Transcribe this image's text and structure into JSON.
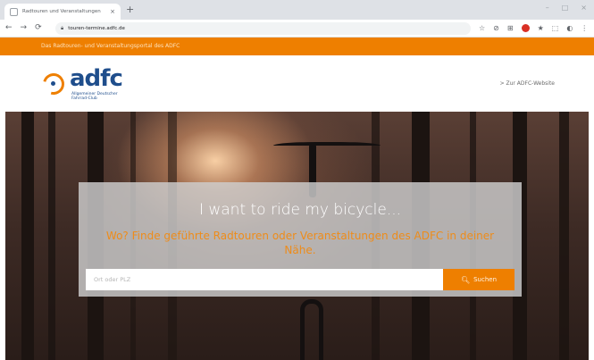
{
  "browser": {
    "tab_title": "Radtouren und Veranstaltungen",
    "tab_close": "×",
    "new_tab": "+",
    "url": "touren-termine.adfc.de",
    "nav": {
      "back": "←",
      "forward": "→",
      "reload": "⟳"
    },
    "window_controls": [
      "–",
      "□",
      "×"
    ],
    "extensions": [
      "☆",
      "⊘",
      "⊞",
      "⬤",
      "★",
      "⬚",
      "◐",
      "⋮"
    ]
  },
  "banner": {
    "text": "Das Radtouren- und Veranstaltungsportal des ADFC"
  },
  "header": {
    "logo_word": "adfc",
    "logo_subtitle": "Allgemeiner Deutscher Fahrrad-Club",
    "external_link": "> Zur ADFC-Website"
  },
  "hero": {
    "title": "I want to ride my bicycle...",
    "subtitle": "Wo? Finde geführte Radtouren oder Veranstaltungen des ADFC in deiner Nähe.",
    "search": {
      "placeholder": "Ort oder PLZ",
      "button_icon": "🔍︎",
      "button_label": "Suchen"
    }
  },
  "colors": {
    "brand_orange": "#ee7f00",
    "brand_blue": "#1f4e8c"
  }
}
